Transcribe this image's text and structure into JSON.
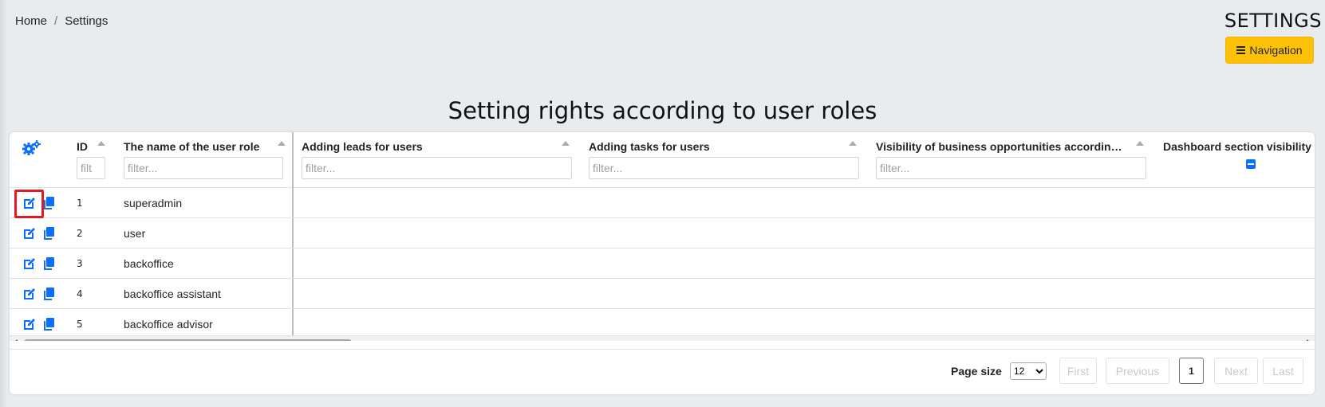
{
  "breadcrumb": {
    "home": "Home",
    "separator": "/",
    "current": "Settings"
  },
  "header": {
    "title": "SETTINGS",
    "nav_button": "Navigation",
    "nav_icon": "bars-icon"
  },
  "page": {
    "heading": "Setting rights according to user roles"
  },
  "colors": {
    "accent": "#0d6efd",
    "warning": "#ffc107",
    "highlight": "#e01b24"
  },
  "table": {
    "settings_icon": "gears-icon",
    "columns": {
      "id": {
        "label": "ID",
        "placeholder": "filt"
      },
      "name": {
        "label": "The name of the user role",
        "placeholder": "filter..."
      },
      "leads": {
        "label": "Adding leads for users",
        "placeholder": "filter..."
      },
      "tasks": {
        "label": "Adding tasks for users",
        "placeholder": "filter..."
      },
      "visibility": {
        "label": "Visibility of business opportunities accordin…",
        "placeholder": "filter..."
      },
      "dashboard": {
        "label": "Dashboard section visibility"
      }
    },
    "rows": [
      {
        "id": "1",
        "name": "superadmin"
      },
      {
        "id": "2",
        "name": "user"
      },
      {
        "id": "3",
        "name": "backoffice"
      },
      {
        "id": "4",
        "name": "backoffice assistant"
      },
      {
        "id": "5",
        "name": "backoffice advisor"
      }
    ]
  },
  "pager": {
    "page_size_label": "Page size",
    "page_size_value": "12",
    "first": "First",
    "previous": "Previous",
    "current_page": "1",
    "next": "Next",
    "last": "Last"
  }
}
